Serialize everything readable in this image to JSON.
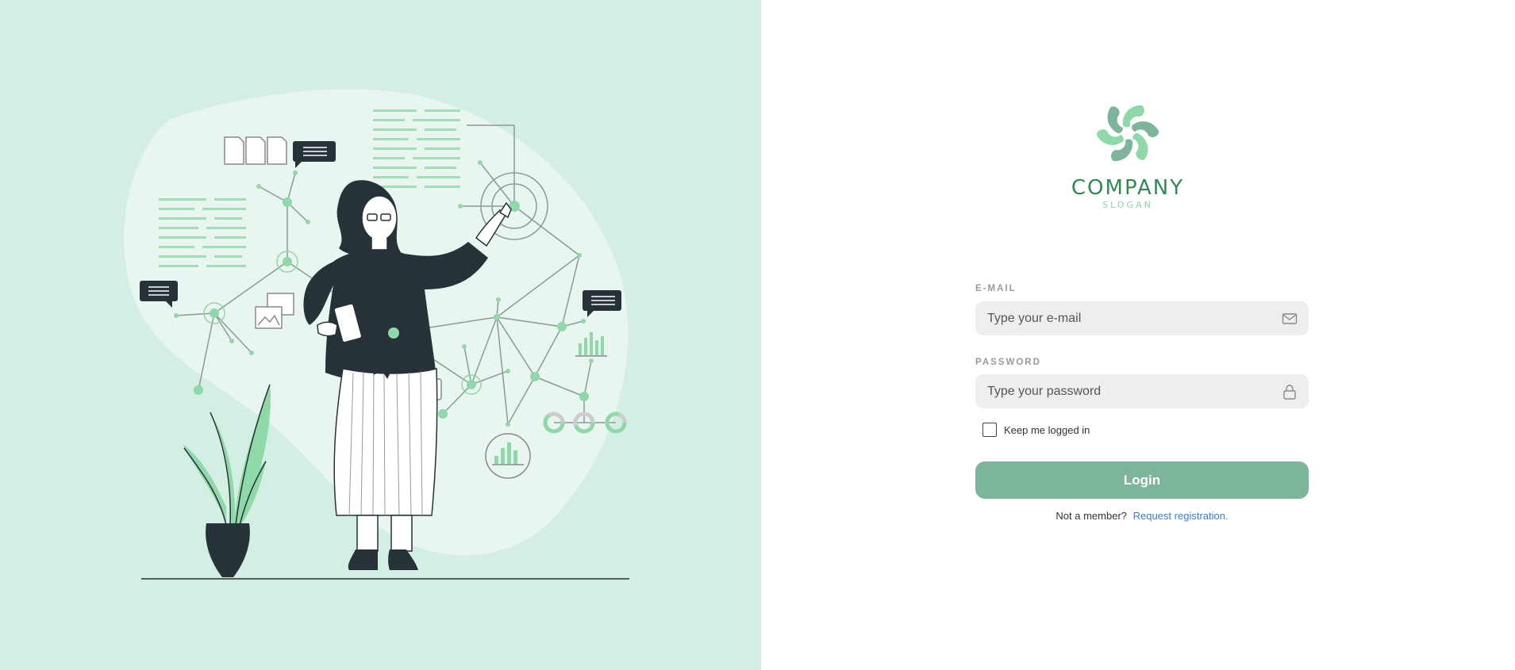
{
  "brand": {
    "name": "COMPANY",
    "slogan": "SLOGAN",
    "colors": {
      "panel_background": "#d3eee2",
      "accent_green": "#8fd9a8",
      "dark_green": "#2f8a55",
      "button_green": "#7db59b",
      "link_blue": "#3b7bd4"
    }
  },
  "illustration": {
    "description_icons": [
      "woman-with-tablet-illustration",
      "plant-icon",
      "network-graph",
      "chat-bubble-icon",
      "document-icon",
      "image-icon",
      "bar-chart-icon",
      "donut-chart-icon"
    ]
  },
  "form": {
    "email": {
      "label": "E-MAIL",
      "placeholder": "Type your e-mail",
      "value": "",
      "icon": "mail-icon"
    },
    "password": {
      "label": "PASSWORD",
      "placeholder": "Type your password",
      "value": "",
      "icon": "lock-icon"
    },
    "remember": {
      "label": "Keep me logged in",
      "checked": false
    },
    "submit_label": "Login",
    "register": {
      "prompt": "Not a member?",
      "link_text": "Request registration."
    }
  }
}
